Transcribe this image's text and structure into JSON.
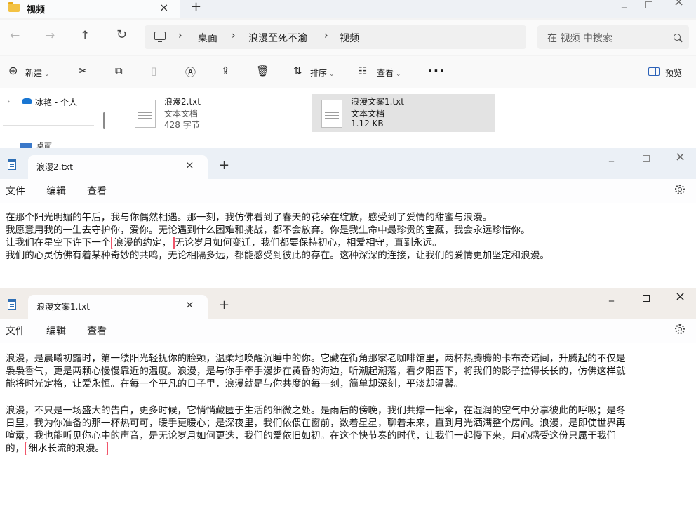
{
  "explorer": {
    "tab_title": "视频",
    "tab_close": "×",
    "new_tab": "+",
    "breadcrumb": [
      "桌面",
      "浪漫至死不渝",
      "视频"
    ],
    "breadcrumb_sep": "›",
    "search_placeholder": "在 视频 中搜索",
    "toolbar": {
      "new_label": "新建",
      "sort_label": "排序",
      "view_label": "查看",
      "more_label": "···",
      "preview_label": "预览"
    },
    "nav": {
      "item_label": "冰艳 - 个人",
      "partial_item": "桌面"
    },
    "files": [
      {
        "name": "浪漫2.txt",
        "type": "文本文档",
        "size": "428 字节",
        "selected": false
      },
      {
        "name": "浪漫文案1.txt",
        "type": "文本文档",
        "size": "1.12 KB",
        "selected": true
      }
    ]
  },
  "notepad1": {
    "tab_title": "浪漫2.txt",
    "tab_close": "×",
    "new_tab": "+",
    "menu": [
      "文件",
      "编辑",
      "查看"
    ],
    "lines": [
      {
        "text": "在那个阳光明媚的午后，我与你偶然相遇。那一刻，我仿佛看到了春天的花朵在绽放，感受到了爱情的甜蜜与浪漫。"
      },
      {
        "text": "我愿意用我的一生去守护你，爱你。无论遇到什么困难和挑战，都不会放弃。你是我生命中最珍贵的宝藏，我会永远珍惜你。"
      },
      {
        "before": "让我们在星空下许下一个",
        "highlight": "浪漫的约定，",
        "after": "无论岁月如何变迁，我们都要保持初心，相爱相守，直到永远。"
      },
      {
        "text": "我们的心灵仿佛有着某种奇妙的共鸣，无论相隔多远，都能感受到彼此的存在。这种深深的连接，让我们的爱情更加坚定和浪漫。"
      }
    ]
  },
  "notepad2": {
    "tab_title": "浪漫文案1.txt",
    "tab_close": "×",
    "new_tab": "+",
    "menu": [
      "文件",
      "编辑",
      "查看"
    ],
    "para1": [
      "浪漫，是晨曦初露时，第一缕阳光轻抚你的脸颊，温柔地唤醒沉睡中的你。它藏在街角那家老咖啡馆里，两杯热腾腾的卡布奇诺间，升腾起的不仅是",
      "袅袅香气，更是两颗心慢慢靠近的温度。浪漫，是与你手牵手漫步在黄昏的海边，听潮起潮落，看夕阳西下，将我们的影子拉得长长的，仿佛这样就",
      "能将时光定格，让爱永恒。在每一个平凡的日子里，浪漫就是与你共度的每一刻，简单却深刻，平淡却温馨。"
    ],
    "para2": [
      "浪漫，不只是一场盛大的告白，更多时候，它悄悄藏匿于生活的细微之处。是雨后的傍晚，我们共撑一把伞，在湿润的空气中分享彼此的呼吸；是冬",
      "日里，我为你准备的那一杯热可可，暖手更暖心；是深夜里，我们依偎在窗前，数着星星，聊着未来，直到月光洒满整个房间。浪漫，是即使世界再",
      "喧嚣，我也能听见你心中的声音，是无论岁月如何更迭，我们的爱依旧如初。在这个快节奏的时代，让我们一起慢下来，用心感受这份只属于我们"
    ],
    "last_line": {
      "before": "的，",
      "highlight": "细水长流的浪漫。"
    }
  }
}
